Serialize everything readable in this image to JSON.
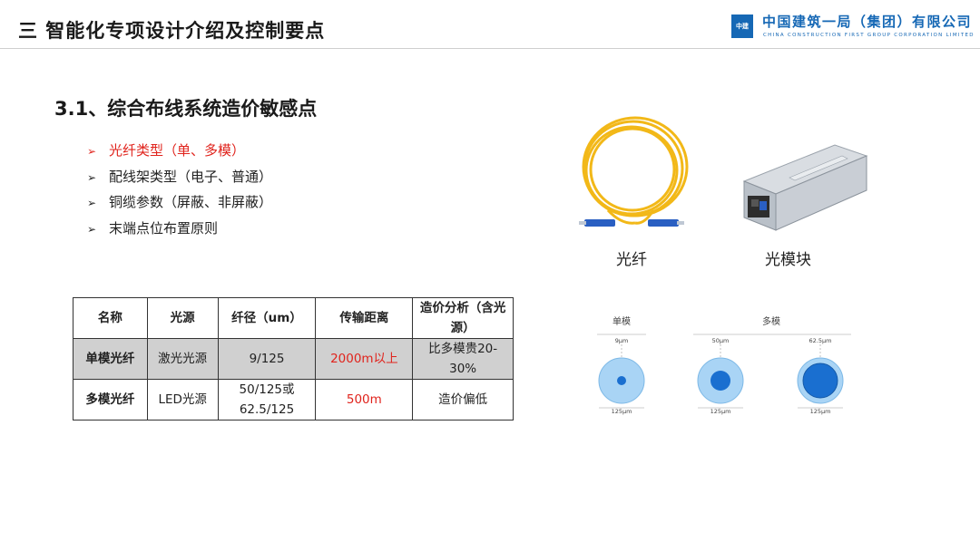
{
  "header": {
    "title": "三  智能化专项设计介绍及控制要点",
    "company_cn": "中国建筑一局（集团）有限公司",
    "company_en": "CHINA CONSTRUCTION FIRST GROUP CORPORATION LIMITED",
    "logo_text": "中建"
  },
  "section": {
    "title": "3.1、综合布线系统造价敏感点",
    "bullets": [
      {
        "text": "光纤类型（单、多模）",
        "highlight": true
      },
      {
        "text": "配线架类型（电子、普通）",
        "highlight": false
      },
      {
        "text": "铜缆参数（屏蔽、非屏蔽）",
        "highlight": false
      },
      {
        "text": "末端点位布置原则",
        "highlight": false
      }
    ],
    "bullet_marker": "➢"
  },
  "table": {
    "headers": [
      "名称",
      "光源",
      "纤径（um）",
      "传输距离",
      "造价分析（含光源）"
    ],
    "rows": [
      [
        "单模光纤",
        "激光光源",
        "9/125",
        "2000m以上",
        "比多模贵20-30%"
      ],
      [
        "多模光纤",
        "LED光源",
        "50/125或62.5/125",
        "500m",
        "造价偏低"
      ]
    ]
  },
  "images": {
    "fiber_caption": "光纤",
    "module_caption": "光模块"
  },
  "diagram": {
    "single_mode_label": "单模",
    "multi_mode_label": "多模",
    "core_labels": [
      "9μm",
      "50μm",
      "62.5μm"
    ],
    "cladding_label": "125μm"
  },
  "colors": {
    "accent_red": "#e0231c",
    "brand_blue": "#1668b5",
    "core_blue": "#1a6fd0",
    "cladding_blue": "#a9d4f5",
    "fiber_yellow": "#f2b818"
  }
}
